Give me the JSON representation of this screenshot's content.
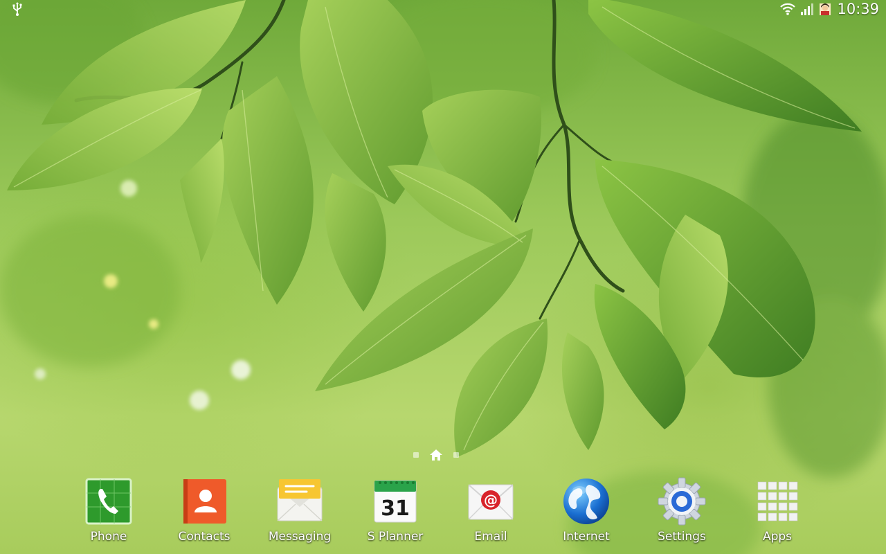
{
  "status_bar": {
    "time": "10:39",
    "icons": [
      "usb-icon",
      "wifi-icon",
      "cell-signal-icon",
      "notification-avatar-icon"
    ]
  },
  "home_indicator": {
    "pages": 3,
    "current": 1,
    "icons": [
      "page-dot-icon",
      "home-icon",
      "page-dot-icon"
    ]
  },
  "dock": {
    "apps": [
      {
        "label": "Phone",
        "icon": "phone-icon"
      },
      {
        "label": "Contacts",
        "icon": "contacts-icon"
      },
      {
        "label": "Messaging",
        "icon": "messaging-icon"
      },
      {
        "label": "S Planner",
        "icon": "calendar-icon",
        "date": "31"
      },
      {
        "label": "Email",
        "icon": "email-icon"
      },
      {
        "label": "Internet",
        "icon": "globe-icon"
      },
      {
        "label": "Settings",
        "icon": "gear-icon"
      },
      {
        "label": "Apps",
        "icon": "app-grid-icon"
      }
    ]
  },
  "colors": {
    "wallpaper_light": "#b7d76e",
    "wallpaper_dark": "#5f9a2e",
    "phone_green": "#2e9a2c",
    "contacts_orange": "#ef5a2a",
    "messaging_yellow": "#f7c631",
    "calendar_green": "#2aa34a",
    "email_red": "#d8232a",
    "internet_blue": "#1a6fd1",
    "settings_blue": "#2a6ad6"
  }
}
